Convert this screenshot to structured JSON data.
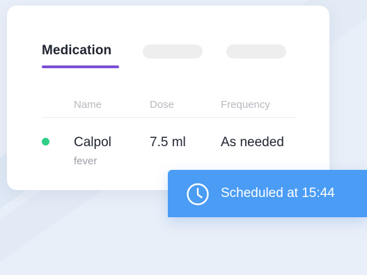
{
  "tabs": {
    "active_label": "Medication"
  },
  "table": {
    "columns": [
      "Name",
      "Dose",
      "Frequency"
    ],
    "rows": [
      {
        "status": "active",
        "name": "Calpol",
        "note": "fever",
        "dose": "7.5 ml",
        "frequency": "As needed"
      }
    ]
  },
  "toast": {
    "icon": "clock-icon",
    "text": "Scheduled at 15:44"
  },
  "colors": {
    "accent": "#7b4fd6",
    "status_active": "#2fce87",
    "toast_bg": "#4a9cf5"
  }
}
